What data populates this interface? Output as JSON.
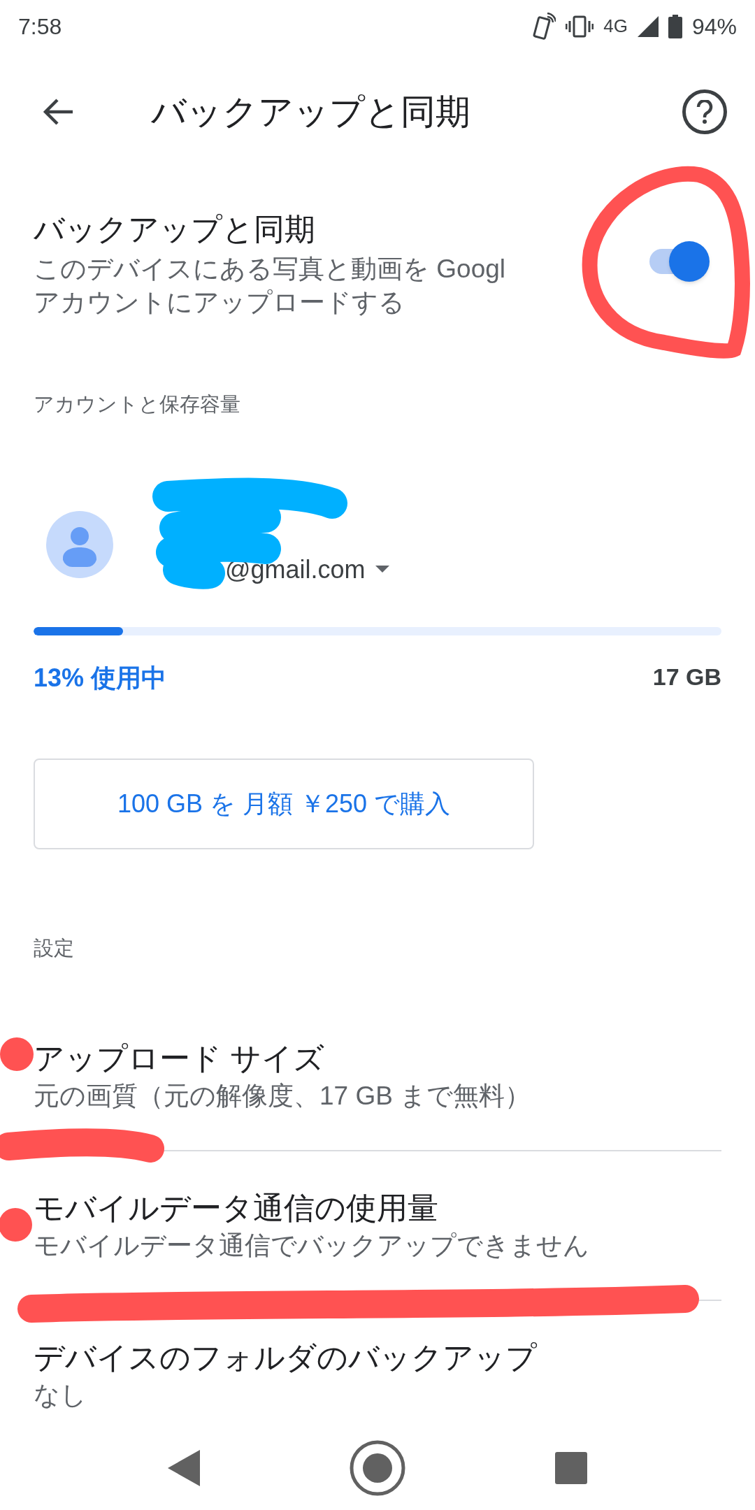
{
  "status_bar": {
    "time": "7:58",
    "network": "4G",
    "battery": "94%"
  },
  "header": {
    "title": "バックアップと同期"
  },
  "backup": {
    "title": "バックアップと同期",
    "description_lines": [
      "このデバイスにある写真と動画を Googl",
      "アカウントにアップロードする"
    ],
    "on": true
  },
  "account_section": {
    "heading": "アカウントと保存容量",
    "email": "@gmail.com",
    "storage": {
      "level": 0.13,
      "usage": "13% 使用中",
      "total": "17 GB"
    },
    "buy_button": "100 GB を 月額 ￥250 で購入"
  },
  "settings_section": {
    "heading": "設定",
    "items": [
      {
        "title": "アップロード サイズ",
        "subtitle": "元の画質（元の解像度、17 GB まで無料）"
      },
      {
        "title": "モバイルデータ通信の使用量",
        "subtitle": "モバイルデータ通信でバックアップできません"
      },
      {
        "title": "デバイスのフォルダのバックアップ",
        "subtitle": "なし"
      }
    ]
  }
}
